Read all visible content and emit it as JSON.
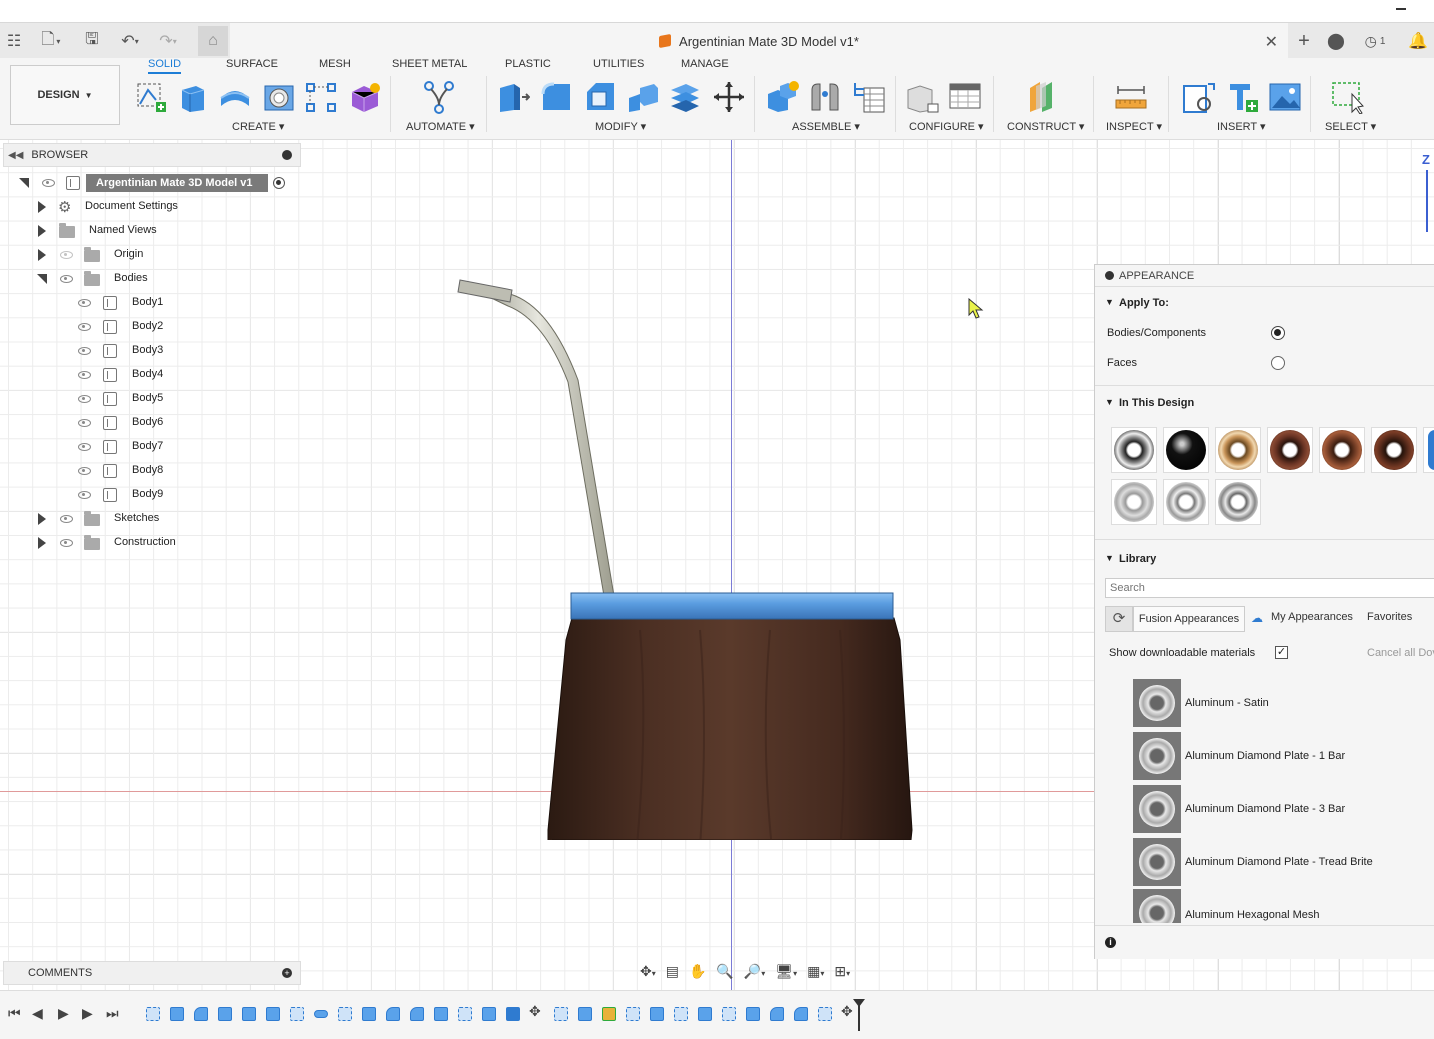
{
  "window": {
    "document_title": "Argentinian Mate 3D Model v1*",
    "job_count": "1"
  },
  "ribbon": {
    "workspace": "DESIGN",
    "tabs": [
      "SOLID",
      "SURFACE",
      "MESH",
      "SHEET METAL",
      "PLASTIC",
      "UTILITIES",
      "MANAGE"
    ],
    "active_tab": "SOLID",
    "groups": [
      "CREATE",
      "AUTOMATE",
      "MODIFY",
      "ASSEMBLE",
      "CONFIGURE",
      "CONSTRUCT",
      "INSPECT",
      "INSERT",
      "SELECT"
    ]
  },
  "browser": {
    "title": "BROWSER",
    "root": "Argentinian Mate 3D Model v1",
    "items": [
      {
        "label": "Document Settings"
      },
      {
        "label": "Named Views"
      },
      {
        "label": "Origin"
      },
      {
        "label": "Bodies"
      },
      {
        "label": "Sketches"
      },
      {
        "label": "Construction"
      }
    ],
    "bodies": [
      "Body1",
      "Body2",
      "Body3",
      "Body4",
      "Body5",
      "Body6",
      "Body7",
      "Body8",
      "Body9"
    ]
  },
  "comments": {
    "title": "COMMENTS"
  },
  "viewcube": {
    "axis_label": "Z"
  },
  "appearance": {
    "title": "APPEARANCE",
    "apply_to_label": "Apply To:",
    "option_bodies": "Bodies/Components",
    "option_faces": "Faces",
    "selected_option": "Bodies/Components",
    "in_this_design_label": "In This Design",
    "library_label": "Library",
    "search_placeholder": "Search",
    "lib_tabs": [
      "Fusion Appearances",
      "My Appearances",
      "Favorites"
    ],
    "show_downloadable_label": "Show downloadable materials",
    "show_downloadable_checked": true,
    "cancel_label": "Cancel all Dov",
    "library_items": [
      "Aluminum - Satin",
      "Aluminum Diamond Plate - 1 Bar",
      "Aluminum Diamond Plate - 3 Bar",
      "Aluminum Diamond Plate - Tread Brite",
      "Aluminum Hexagonal Mesh"
    ]
  }
}
